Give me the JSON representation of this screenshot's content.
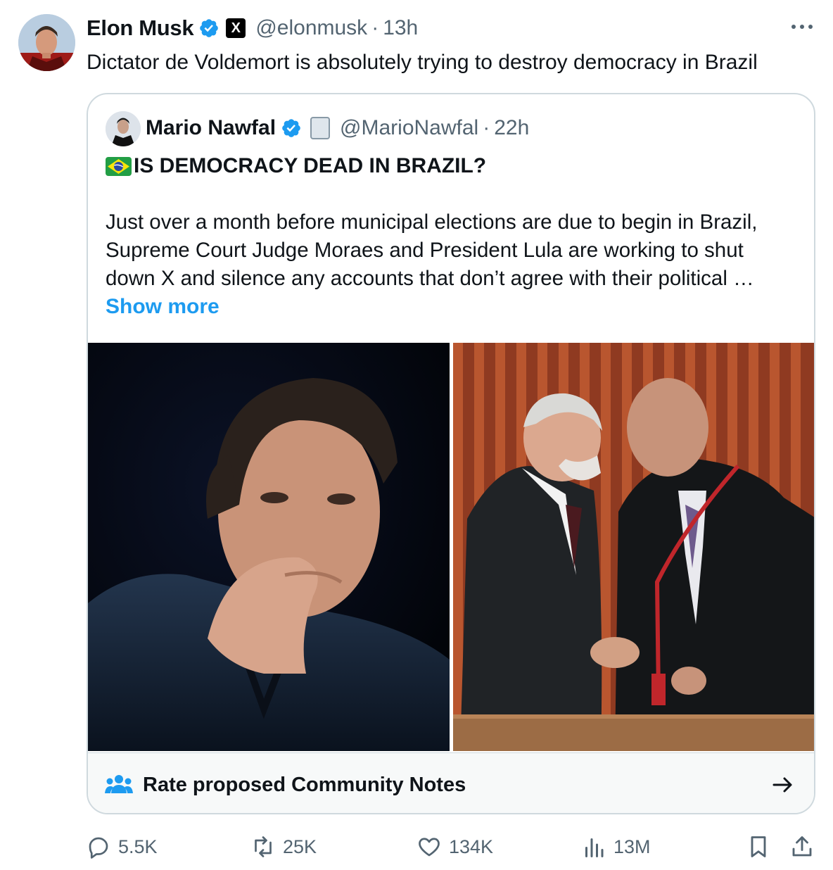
{
  "tweet": {
    "author": {
      "name": "Elon Musk",
      "handle": "@elonmusk",
      "time": "13h",
      "separator": "·",
      "badge_letter": "X"
    },
    "text": "Dictator de Voldemort is absolutely trying to destroy democracy in Brazil"
  },
  "quote": {
    "author": {
      "name": "Mario Nawfal",
      "handle": "@MarioNawfal",
      "time": "22h",
      "separator": "·"
    },
    "title": "IS DEMOCRACY DEAD IN BRAZIL?",
    "body_lines": [
      "Just over a month before municipal elections are due to begin in Brazil,",
      "Supreme Court Judge Moraes and President Lula are working to shut",
      "down X and silence any accounts that don’t agree with their political …"
    ],
    "show_more": "Show more",
    "images": [
      "photo-man-hand-on-chin",
      "photo-two-men-handshake"
    ]
  },
  "community_notes": {
    "label": "Rate proposed Community Notes",
    "icon": "people-icon",
    "arrow": "arrow-right-icon"
  },
  "actions": {
    "replies": "5.5K",
    "reposts": "25K",
    "likes": "134K",
    "views": "13M"
  },
  "colors": {
    "accent": "#1d9bf0",
    "text": "#0f1419",
    "muted": "#536471",
    "border": "#cfd9de"
  }
}
